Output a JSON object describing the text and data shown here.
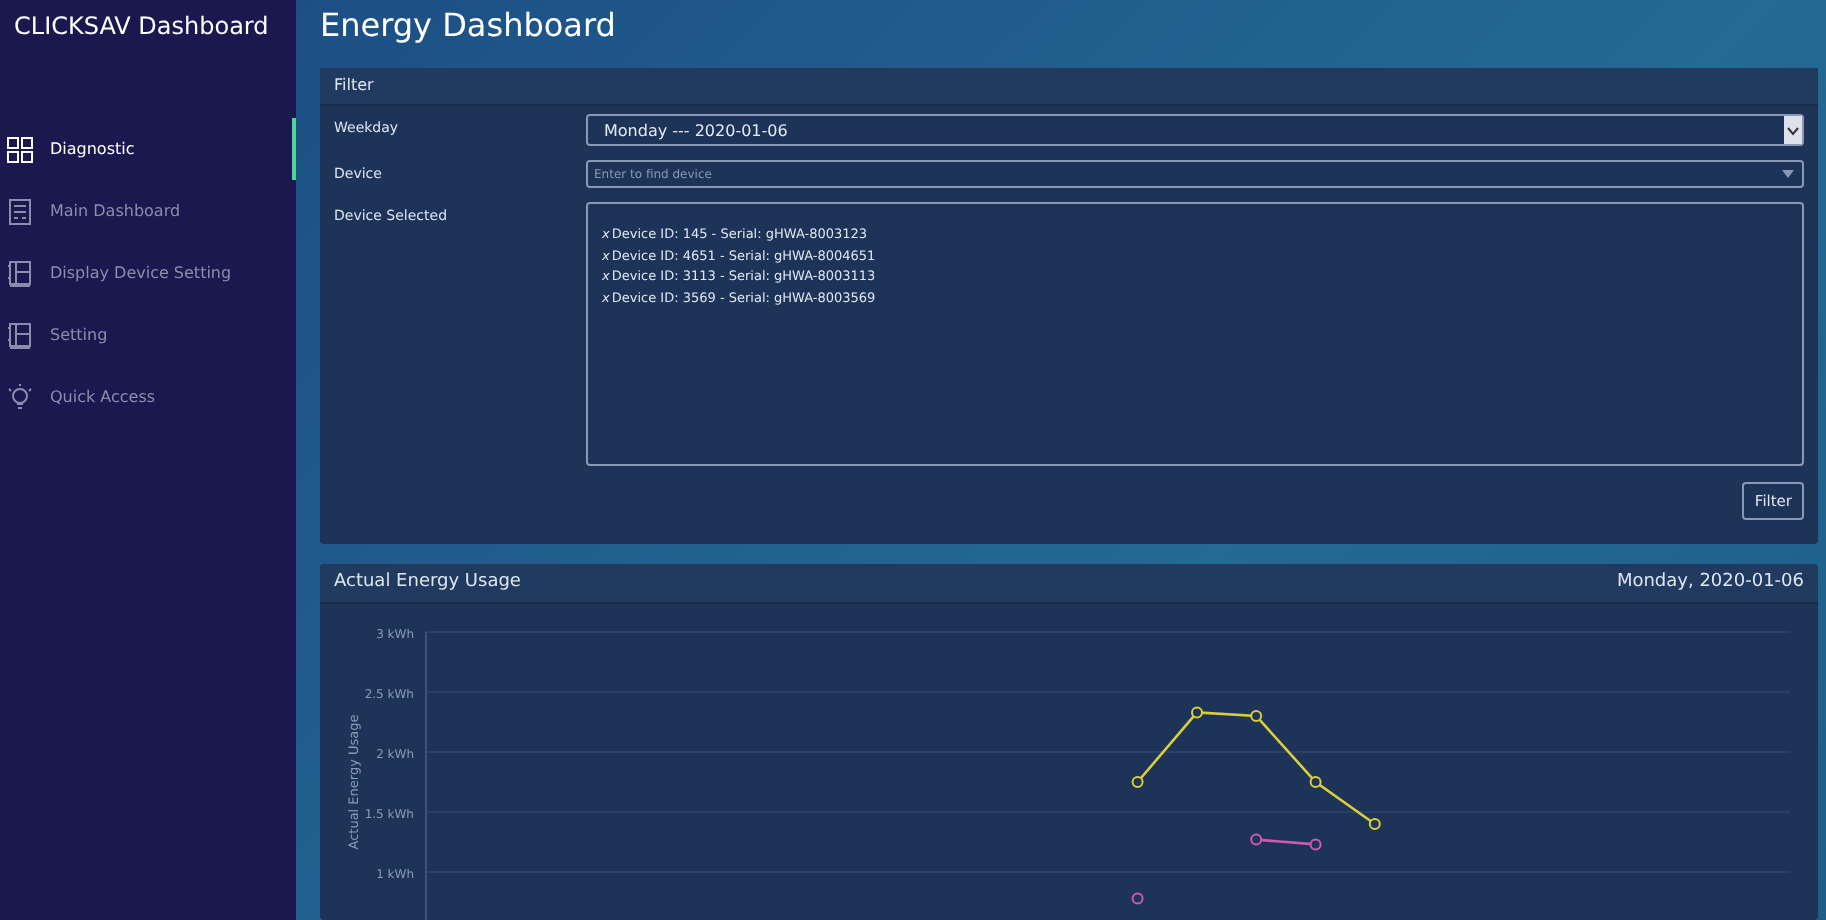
{
  "sidebar": {
    "title": "CLICKSAV Dashboard",
    "items": [
      {
        "label": "Diagnostic",
        "selected": true
      },
      {
        "label": "Main Dashboard",
        "selected": false
      },
      {
        "label": "Display Device Setting",
        "selected": false
      },
      {
        "label": "Setting",
        "selected": false
      },
      {
        "label": "Quick Access",
        "selected": false
      }
    ]
  },
  "page_title": "Energy Dashboard",
  "filter": {
    "title": "Filter",
    "weekday_label": "Weekday",
    "weekday_value": "Monday --- 2020-01-06",
    "device_label": "Device",
    "device_placeholder": "Enter to find device",
    "selected_label": "Device Selected",
    "selected_devices": [
      {
        "remove": "x",
        "text": "Device ID: 145 - Serial: gHWA-8003123"
      },
      {
        "remove": "x",
        "text": "Device ID: 4651 - Serial: gHWA-8004651"
      },
      {
        "remove": "x",
        "text": "Device ID: 3113 - Serial: gHWA-8003113"
      },
      {
        "remove": "x",
        "text": "Device ID: 3569 - Serial: gHWA-8003569"
      }
    ],
    "button": "Filter"
  },
  "usage": {
    "title": "Actual Energy Usage",
    "date": "Monday, 2020-01-06",
    "chart_data": {
      "type": "line",
      "ylabel": "Actual Energy Usage",
      "grid": true,
      "ylim": [
        0.6,
        3
      ],
      "yticks": [
        {
          "value": 1,
          "label": "1 kWh"
        },
        {
          "value": 1.5,
          "label": "1.5 kWh"
        },
        {
          "value": 2,
          "label": "2 kWh"
        },
        {
          "value": 2.5,
          "label": "2.5 kWh"
        },
        {
          "value": 3,
          "label": "3 kWh"
        }
      ],
      "series": [
        {
          "color": "#d8cf3a",
          "marker": "circle",
          "values": [
            null,
            null,
            null,
            null,
            null,
            null,
            null,
            null,
            null,
            null,
            null,
            null,
            1.75,
            2.33,
            2.3,
            1.75,
            1.4,
            null,
            null,
            null,
            null,
            null,
            null,
            null
          ]
        },
        {
          "color": "#d05ab0",
          "marker": "circle",
          "values": [
            null,
            null,
            null,
            null,
            null,
            null,
            null,
            null,
            null,
            null,
            null,
            null,
            0.78,
            null,
            1.27,
            1.23,
            null,
            null,
            null,
            null,
            null,
            null,
            null,
            null
          ]
        }
      ]
    }
  }
}
